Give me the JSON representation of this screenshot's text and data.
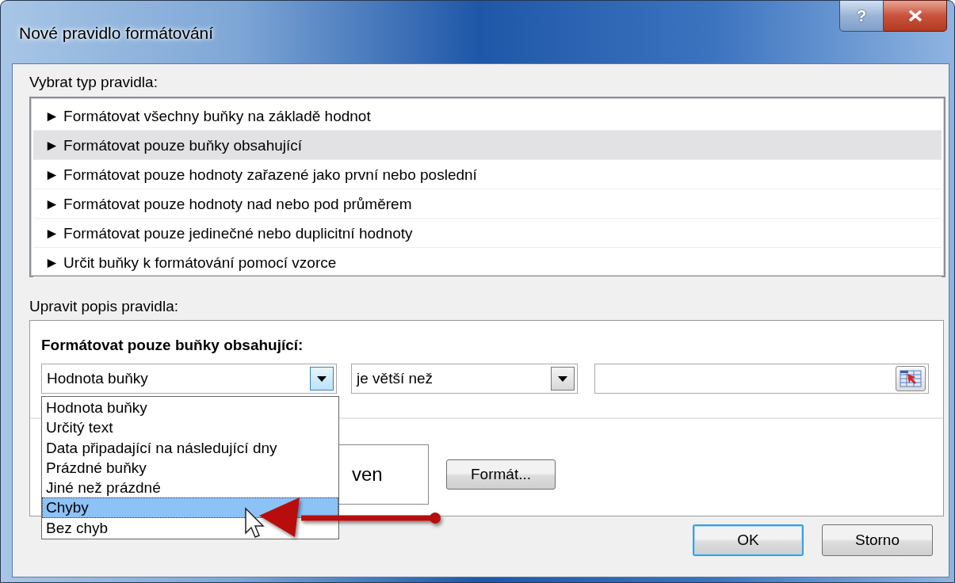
{
  "window": {
    "title": "Nové pravidlo formátování",
    "help_button": "?"
  },
  "rule_type": {
    "label": "Vybrat typ pravidla:",
    "items": [
      {
        "text": "► Formátovat všechny buňky na základě hodnot",
        "selected": false
      },
      {
        "text": "► Formátovat pouze buňky obsahující",
        "selected": true
      },
      {
        "text": "► Formátovat pouze hodnoty zařazené jako první nebo poslední",
        "selected": false
      },
      {
        "text": "► Formátovat pouze hodnoty nad nebo pod průměrem",
        "selected": false
      },
      {
        "text": "► Formátovat pouze jedinečné nebo duplicitní hodnoty",
        "selected": false
      },
      {
        "text": "► Určit buňky k formátování pomocí vzorce",
        "selected": false
      }
    ]
  },
  "description": {
    "label": "Upravit popis pravidla:",
    "heading": "Formátovat pouze buňky obsahující:",
    "condition_combo": {
      "value": "Hodnota buňky",
      "expanded": true
    },
    "operator_combo": {
      "value": "je větší než"
    },
    "dropdown_options": [
      {
        "text": "Hodnota buňky",
        "selected": false
      },
      {
        "text": "Určitý text",
        "selected": false
      },
      {
        "text": "Data připadající na následující dny",
        "selected": false
      },
      {
        "text": "Prázdné buňky",
        "selected": false
      },
      {
        "text": "Jiné než prázdné",
        "selected": false
      },
      {
        "text": "Chyby",
        "selected": true
      },
      {
        "text": "Bez chyb",
        "selected": false
      }
    ],
    "preview": {
      "text": "ven"
    },
    "format_button": "Formát..."
  },
  "buttons": [
    {
      "label": "OK",
      "default": true
    },
    {
      "label": "Storno",
      "default": false
    }
  ]
}
